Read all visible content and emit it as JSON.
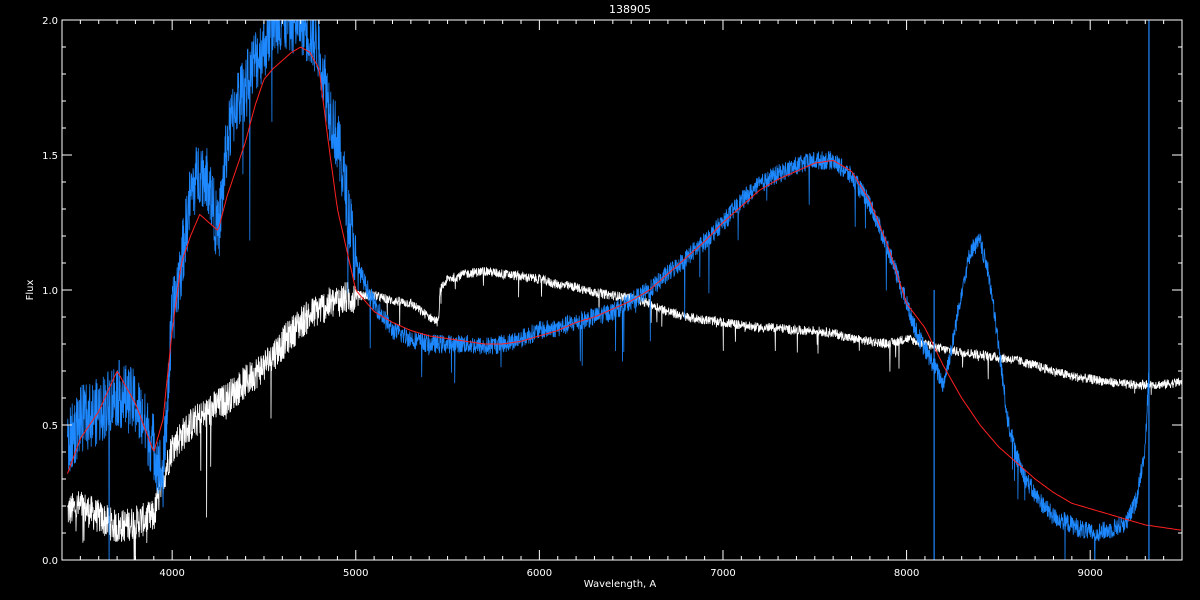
{
  "chart_data": {
    "type": "line",
    "title": "138905",
    "xlabel": "Wavelength, A",
    "ylabel": "Flux",
    "xlim": [
      3400,
      9500
    ],
    "ylim": [
      0.0,
      2.0
    ],
    "x_ticks": [
      4000,
      5000,
      6000,
      7000,
      8000,
      9000
    ],
    "x_tick_labels": [
      "4000",
      "5000",
      "6000",
      "7000",
      "8000",
      "9000"
    ],
    "y_ticks": [
      0.0,
      0.5,
      1.0,
      1.5,
      2.0
    ],
    "y_tick_labels": [
      "0.0",
      "0.5",
      "1.0",
      "1.5",
      "2.0"
    ],
    "grid": false,
    "background": "#000000",
    "series": [
      {
        "color": "#ffffff",
        "noise": 0.07,
        "x": [
          3430,
          3500,
          3600,
          3700,
          3800,
          3900,
          3950,
          4000,
          4100,
          4200,
          4300,
          4400,
          4500,
          4600,
          4700,
          4800,
          4900,
          5000,
          5100,
          5200,
          5300,
          5400,
          5450,
          5460,
          5500,
          5600,
          5700,
          5800,
          5900,
          6000,
          6100,
          6200,
          6300,
          6400,
          6500,
          6600,
          6700,
          6800,
          6900,
          7000,
          7100,
          7200,
          7300,
          7400,
          7500,
          7600,
          7650,
          7700,
          7800,
          7900,
          8000,
          8100,
          8200,
          8300,
          8400,
          8500,
          8600,
          8700,
          8800,
          8900,
          9000,
          9100,
          9200,
          9300,
          9400,
          9500
        ],
        "y": [
          0.18,
          0.2,
          0.16,
          0.12,
          0.14,
          0.16,
          0.3,
          0.42,
          0.5,
          0.55,
          0.6,
          0.66,
          0.72,
          0.8,
          0.88,
          0.93,
          0.96,
          0.98,
          0.98,
          0.96,
          0.95,
          0.9,
          0.88,
          1.0,
          1.04,
          1.06,
          1.07,
          1.06,
          1.05,
          1.04,
          1.02,
          1.01,
          0.99,
          0.98,
          0.97,
          0.95,
          0.92,
          0.9,
          0.89,
          0.88,
          0.87,
          0.86,
          0.86,
          0.85,
          0.85,
          0.84,
          0.83,
          0.82,
          0.81,
          0.8,
          0.82,
          0.8,
          0.78,
          0.77,
          0.76,
          0.75,
          0.74,
          0.72,
          0.7,
          0.68,
          0.67,
          0.66,
          0.65,
          0.65,
          0.65,
          0.66
        ]
      },
      {
        "color": "#1e88ff",
        "noise": 0.14,
        "x": [
          3430,
          3500,
          3600,
          3700,
          3800,
          3900,
          3950,
          4000,
          4050,
          4100,
          4150,
          4200,
          4250,
          4300,
          4350,
          4400,
          4450,
          4500,
          4550,
          4600,
          4650,
          4700,
          4750,
          4800,
          4850,
          4900,
          4950,
          5000,
          5100,
          5200,
          5300,
          5400,
          5500,
          5600,
          5700,
          5800,
          5900,
          6000,
          6100,
          6200,
          6300,
          6400,
          6500,
          6600,
          6700,
          6800,
          6900,
          7000,
          7100,
          7200,
          7300,
          7400,
          7500,
          7600,
          7700,
          7800,
          7900,
          8000,
          8050,
          8100,
          8150,
          8200,
          8250,
          8300,
          8350,
          8400,
          8450,
          8500,
          8550,
          8600,
          8650,
          8700,
          8800,
          8900,
          9000,
          9100,
          9200,
          9250,
          9300,
          9320
        ],
        "y": [
          0.42,
          0.52,
          0.55,
          0.62,
          0.58,
          0.42,
          0.3,
          0.9,
          1.1,
          1.35,
          1.45,
          1.4,
          1.2,
          1.55,
          1.7,
          1.75,
          1.85,
          1.9,
          2.0,
          2.0,
          2.0,
          2.0,
          1.95,
          1.9,
          1.7,
          1.55,
          1.35,
          1.1,
          0.95,
          0.85,
          0.82,
          0.8,
          0.8,
          0.8,
          0.79,
          0.8,
          0.82,
          0.85,
          0.86,
          0.88,
          0.9,
          0.92,
          0.96,
          1.0,
          1.06,
          1.12,
          1.18,
          1.25,
          1.33,
          1.39,
          1.43,
          1.46,
          1.48,
          1.48,
          1.42,
          1.32,
          1.15,
          0.95,
          0.85,
          0.78,
          0.72,
          0.65,
          0.8,
          1.0,
          1.15,
          1.18,
          1.05,
          0.8,
          0.52,
          0.38,
          0.3,
          0.24,
          0.16,
          0.13,
          0.1,
          0.11,
          0.14,
          0.22,
          0.42,
          0.7
        ]
      },
      {
        "color": "#ff2020",
        "noise": 0.0,
        "x": [
          3430,
          3500,
          3600,
          3700,
          3800,
          3900,
          3950,
          4000,
          4050,
          4100,
          4150,
          4200,
          4250,
          4300,
          4350,
          4400,
          4450,
          4500,
          4550,
          4600,
          4650,
          4700,
          4750,
          4800,
          4850,
          4900,
          4950,
          5000,
          5100,
          5200,
          5300,
          5400,
          5500,
          5600,
          5700,
          5800,
          5900,
          6000,
          6100,
          6200,
          6300,
          6400,
          6500,
          6600,
          6700,
          6800,
          6900,
          7000,
          7100,
          7200,
          7300,
          7400,
          7500,
          7600,
          7700,
          7800,
          7900,
          8000,
          8100,
          8200,
          8300,
          8400,
          8500,
          8600,
          8700,
          8800,
          8900,
          9000,
          9100,
          9200,
          9300,
          9400,
          9500
        ],
        "y": [
          0.32,
          0.45,
          0.55,
          0.7,
          0.58,
          0.4,
          0.52,
          0.85,
          1.1,
          1.2,
          1.28,
          1.25,
          1.22,
          1.35,
          1.45,
          1.55,
          1.68,
          1.78,
          1.82,
          1.85,
          1.88,
          1.9,
          1.88,
          1.82,
          1.55,
          1.3,
          1.15,
          1.0,
          0.92,
          0.88,
          0.85,
          0.83,
          0.82,
          0.81,
          0.8,
          0.8,
          0.81,
          0.83,
          0.85,
          0.88,
          0.9,
          0.93,
          0.96,
          1.0,
          1.06,
          1.12,
          1.18,
          1.25,
          1.31,
          1.37,
          1.41,
          1.44,
          1.47,
          1.48,
          1.44,
          1.33,
          1.16,
          0.95,
          0.86,
          0.72,
          0.6,
          0.5,
          0.42,
          0.36,
          0.3,
          0.25,
          0.21,
          0.19,
          0.17,
          0.15,
          0.13,
          0.12,
          0.11
        ]
      }
    ],
    "spikes": [
      {
        "color": "#1e88ff",
        "x": 8150,
        "y0": 0.0,
        "y1": 1.0
      },
      {
        "color": "#1e88ff",
        "x": 9320,
        "y0": 0.0,
        "y1": 2.0
      }
    ]
  }
}
